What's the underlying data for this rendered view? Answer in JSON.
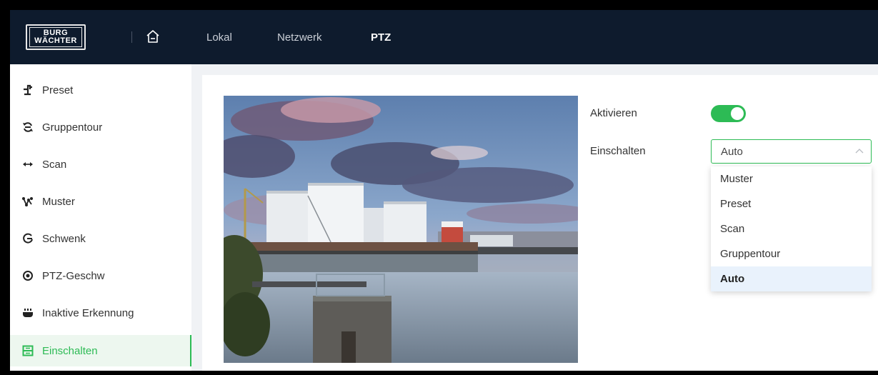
{
  "brand": {
    "line1": "BURG",
    "line2": "WÄCHTER"
  },
  "nav": {
    "tabs": [
      {
        "label": "Lokal"
      },
      {
        "label": "Netzwerk"
      },
      {
        "label": "PTZ"
      }
    ],
    "active": "PTZ"
  },
  "sidebar": {
    "items": [
      {
        "label": "Preset",
        "icon": "preset-icon"
      },
      {
        "label": "Gruppentour",
        "icon": "group-tour-icon"
      },
      {
        "label": "Scan",
        "icon": "scan-icon"
      },
      {
        "label": "Muster",
        "icon": "pattern-icon"
      },
      {
        "label": "Schwenk",
        "icon": "pan-icon"
      },
      {
        "label": "PTZ-Geschw",
        "icon": "ptz-speed-icon"
      },
      {
        "label": "Inaktive Erkennung",
        "icon": "idle-detection-icon"
      },
      {
        "label": "Einschalten",
        "icon": "power-up-icon"
      }
    ],
    "active": "Einschalten"
  },
  "form": {
    "enable_label": "Aktivieren",
    "enable_on": true,
    "power_label": "Einschalten",
    "power_value": "Auto",
    "options": [
      "Muster",
      "Preset",
      "Scan",
      "Gruppentour",
      "Auto"
    ],
    "selected_option": "Auto"
  },
  "colors": {
    "accent": "#2dbb55",
    "topbar": "#0e1b2d",
    "content_bg": "#f0f2f5",
    "selected_option_bg": "#e9f2fc"
  }
}
